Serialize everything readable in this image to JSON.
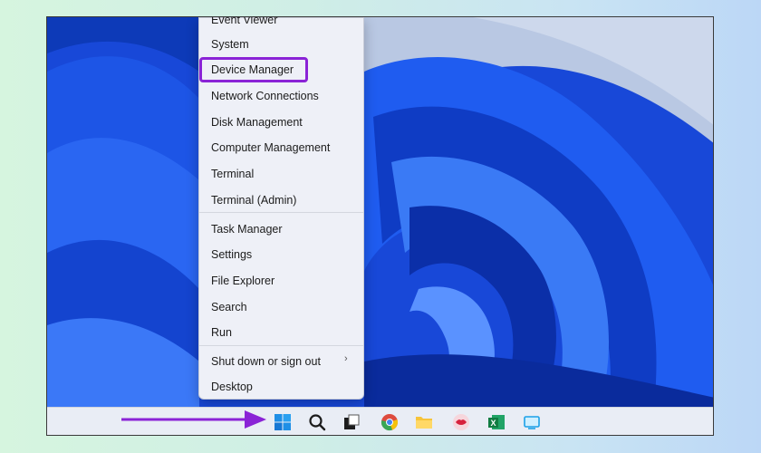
{
  "menu": {
    "items": [
      {
        "label": "Event Viewer"
      },
      {
        "label": "System"
      },
      {
        "label": "Device Manager",
        "highlighted": true
      },
      {
        "label": "Network Connections"
      },
      {
        "label": "Disk Management"
      },
      {
        "label": "Computer Management"
      },
      {
        "label": "Terminal"
      },
      {
        "label": "Terminal (Admin)"
      },
      {
        "label": "Task Manager"
      },
      {
        "label": "Settings"
      },
      {
        "label": "File Explorer"
      },
      {
        "label": "Search"
      },
      {
        "label": "Run"
      },
      {
        "label": "Shut down or sign out",
        "has_submenu": true
      },
      {
        "label": "Desktop"
      }
    ],
    "submenu_glyph": "›"
  },
  "taskbar": {
    "icons": [
      "windows-start-icon",
      "search-icon",
      "task-view-icon",
      "chrome-icon",
      "file-explorer-icon",
      "lips-app-icon",
      "excel-icon",
      "screen-app-icon"
    ]
  },
  "colors": {
    "highlight": "#8a23d6",
    "arrow": "#8a23d6",
    "wallpaper": "#1a4fe0"
  }
}
